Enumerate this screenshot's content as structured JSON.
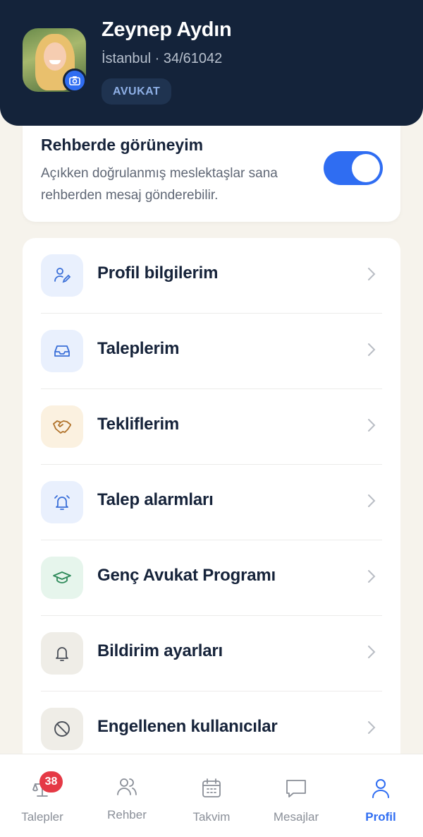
{
  "profile": {
    "name": "Zeynep Aydın",
    "location_line": "İstanbul · 34/61042",
    "role_badge": "AVUKAT"
  },
  "directory_toggle": {
    "title": "Rehberde görüneyim",
    "description": "Açıkken doğrulanmış meslektaşlar sana rehberden mesaj gönderebilir.",
    "enabled": true
  },
  "menu": {
    "items": [
      {
        "label": "Profil bilgilerim",
        "icon": "user-edit-icon",
        "icon_bg": "#e9f0fd",
        "icon_color": "#3a6fd8"
      },
      {
        "label": "Taleplerim",
        "icon": "inbox-icon",
        "icon_bg": "#e9f0fd",
        "icon_color": "#3a6fd8"
      },
      {
        "label": "Tekliflerim",
        "icon": "handshake-icon",
        "icon_bg": "#fbf1e0",
        "icon_color": "#b0722a"
      },
      {
        "label": "Talep alarmları",
        "icon": "alarm-bell-icon",
        "icon_bg": "#e9f0fd",
        "icon_color": "#3a6fd8"
      },
      {
        "label": "Genç Avukat Programı",
        "icon": "graduation-cap-icon",
        "icon_bg": "#e6f5ec",
        "icon_color": "#2e8a5a"
      },
      {
        "label": "Bildirim ayarları",
        "icon": "bell-icon",
        "icon_bg": "#efede7",
        "icon_color": "#4a4f58"
      },
      {
        "label": "Engellenen kullanıcılar",
        "icon": "block-icon",
        "icon_bg": "#efede7",
        "icon_color": "#4a4f58"
      }
    ]
  },
  "tabbar": {
    "tabs": [
      {
        "label": "Talepler",
        "icon": "scales-icon",
        "badge": "38"
      },
      {
        "label": "Rehber",
        "icon": "people-icon"
      },
      {
        "label": "Takvim",
        "icon": "calendar-icon"
      },
      {
        "label": "Mesajlar",
        "icon": "chat-icon"
      },
      {
        "label": "Profil",
        "icon": "person-icon",
        "active": true
      }
    ]
  },
  "colors": {
    "header_bg": "#14233a",
    "accent": "#2f6df2",
    "badge_red": "#e53945",
    "page_bg": "#f6f3ec"
  }
}
